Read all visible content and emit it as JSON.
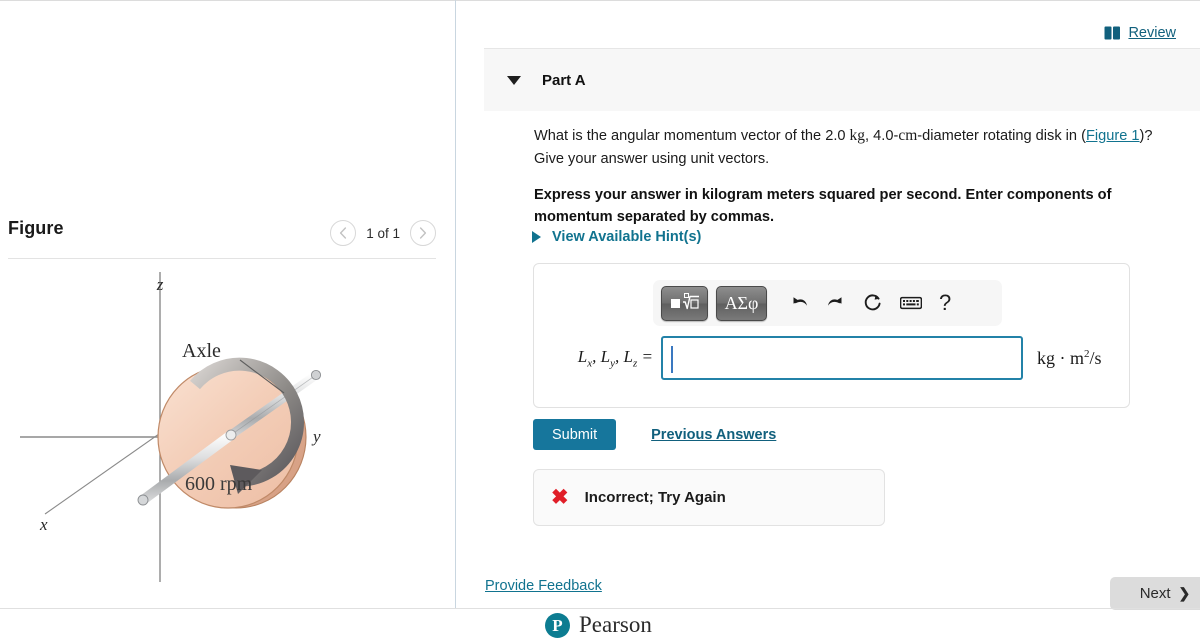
{
  "header": {
    "review_label": "Review",
    "review_icon": "book-icon"
  },
  "part": {
    "label": "Part A",
    "caret_icon": "caret-down-icon"
  },
  "question": {
    "line1_a": "What is the angular momentum vector of the 2.0 ",
    "unit_kg": "kg",
    "line1_b": ", 4.0-",
    "unit_cm": "cm",
    "line1_c": "-diameter rotating disk in",
    "line2_open": "(",
    "figure_link": "Figure 1",
    "line2_rest": ")? Give your answer using unit vectors.",
    "bold_instruction": "Express your answer in kilogram meters squared per second. Enter components of momentum separated by commas."
  },
  "hints": {
    "label": "View Available Hint(s)",
    "caret_icon": "caret-right-icon"
  },
  "answer": {
    "toolbar": {
      "template_button": "template-icon",
      "greek_button": "ΑΣφ",
      "undo_icon": "undo-arrow-icon",
      "redo_icon": "redo-arrow-icon",
      "reset_icon": "reset-circular-arrow-icon",
      "keyboard_icon": "keyboard-icon",
      "help_icon": "?"
    },
    "label_plain": "Lx, Ly, Lz =",
    "label_L": "L",
    "sub_x": "x",
    "sub_y": "y",
    "sub_z": "z",
    "comma": ", ",
    "equals": " =",
    "value": "",
    "placeholder": "",
    "units_kg": "kg",
    "units_dot": " · ",
    "units_m": "m",
    "units_exp": "2",
    "units_per_s": "/s",
    "units_full": "kg · m2/s"
  },
  "actions": {
    "submit_label": "Submit",
    "previous_answers_label": "Previous Answers"
  },
  "feedback": {
    "x_icon": "✖",
    "status_text": "Incorrect; Try Again"
  },
  "footer": {
    "provide_feedback_label": "Provide Feedback",
    "next_label": "Next",
    "next_chevron": "❯",
    "pearson_mark": "P",
    "pearson_word": "Pearson"
  },
  "figure": {
    "title": "Figure",
    "prev_icon": "chevron-left-icon",
    "next_icon": "chevron-right-icon",
    "pager": "1 of 1",
    "axis_z": "z",
    "axis_y": "y",
    "axis_x": "x",
    "axle_label": "Axle",
    "rpm_label": "600 rpm",
    "disk_color": "#f3cdb7",
    "disk_edge_color": "#d79f85",
    "axle_color": "#d9dadb",
    "axis_color": "#8a8a8a"
  },
  "colors": {
    "accent_teal": "#16769c",
    "link_teal": "#11738f",
    "error_red": "#e01e28",
    "panel_gray": "#f7f7f7"
  }
}
